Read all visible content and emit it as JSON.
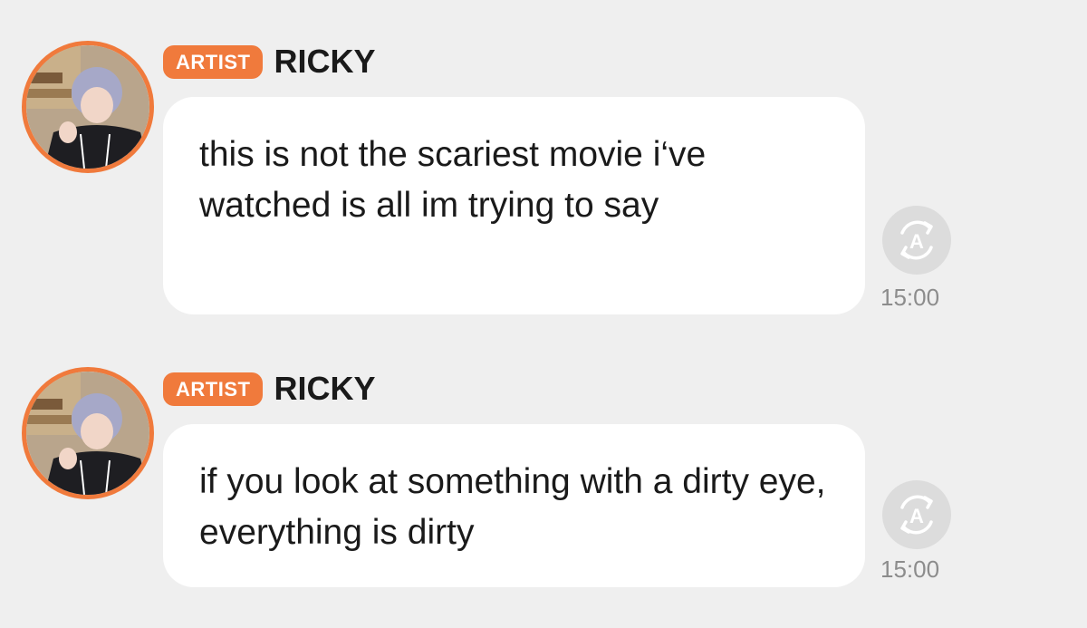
{
  "messages": [
    {
      "badge": "ARTIST",
      "name": "RICKY",
      "text": "this is not the scariest movie i‘ve watched is all im trying to say",
      "time": "15:00",
      "translate_icon": "translate-a-icon"
    },
    {
      "badge": "ARTIST",
      "name": "RICKY",
      "text": "if you look at something with a dirty eye, everything is dirty",
      "time": "15:00",
      "translate_icon": "translate-a-icon"
    }
  ],
  "colors": {
    "background": "#efefef",
    "accent": "#f07a3c",
    "bubble": "#ffffff",
    "time": "#8c8c8c",
    "translate_button": "#dcdcdc"
  }
}
